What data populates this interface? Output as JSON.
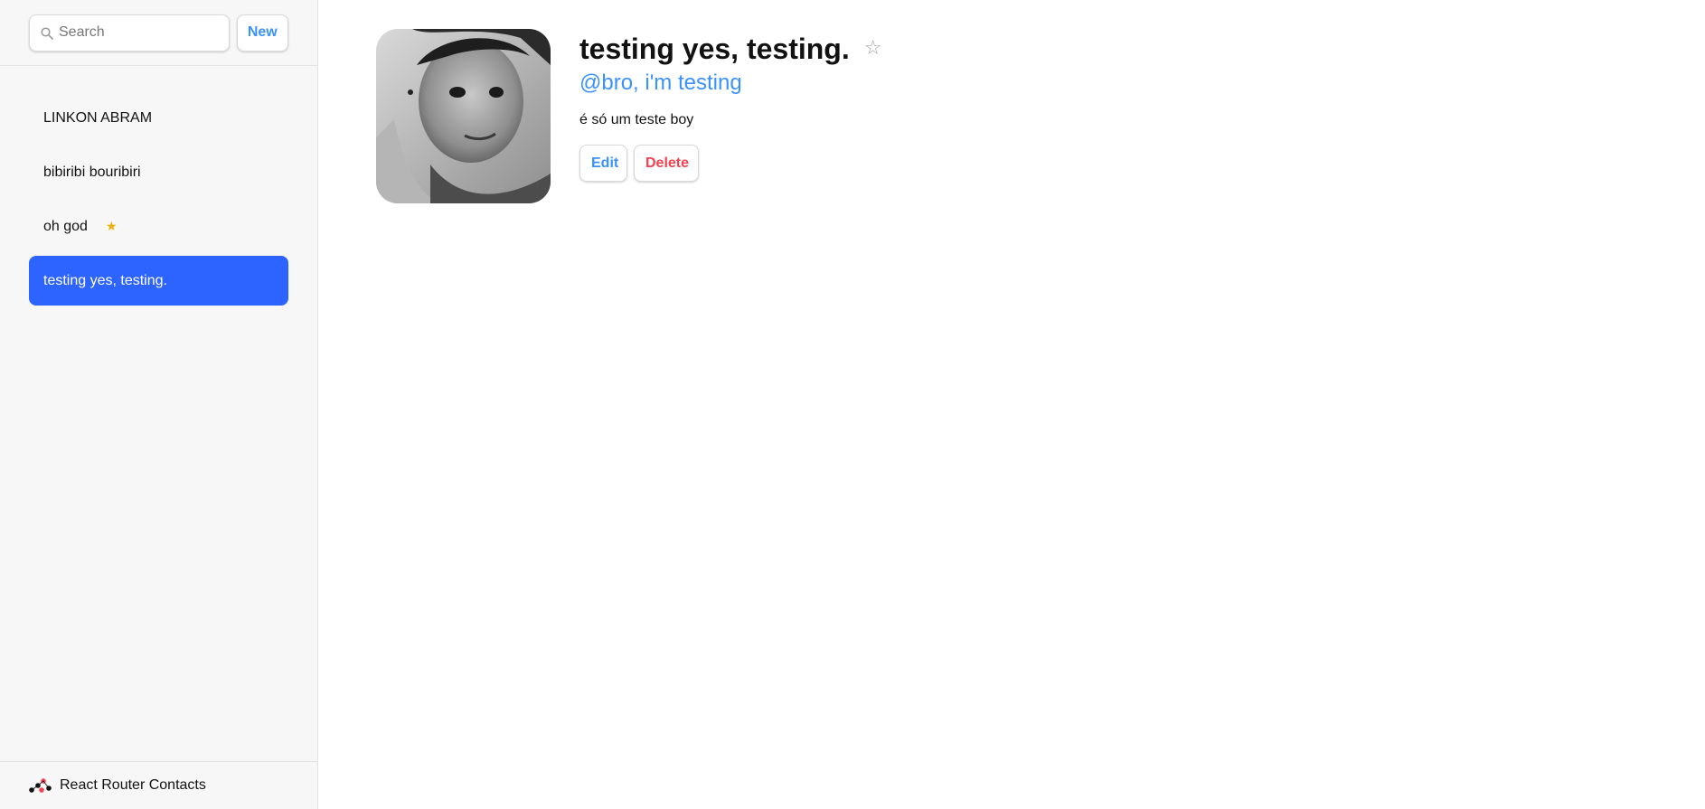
{
  "colors": {
    "accent": "#3992ff",
    "active_item": "#2d64ff",
    "danger": "#f44250",
    "favorite_star": "#eeb004"
  },
  "sidebar": {
    "search": {
      "placeholder": "Search",
      "value": ""
    },
    "new_label": "New",
    "contacts": [
      {
        "name": "LINKON ABRAM",
        "favorite": false,
        "active": false
      },
      {
        "name": "bibiribi bouribiri",
        "favorite": false,
        "active": false
      },
      {
        "name": "oh god",
        "favorite": true,
        "active": false
      },
      {
        "name": "testing yes, testing.",
        "favorite": false,
        "active": true
      }
    ],
    "favorite_icon": "★",
    "footer": {
      "title": "React Router Contacts",
      "logo_icon": "react-router-logo-icon"
    }
  },
  "detail": {
    "name": "testing yes, testing.",
    "favorite_icon": "☆",
    "handle": "@bro, i'm testing",
    "notes": "é só um teste boy",
    "edit_label": "Edit",
    "delete_label": "Delete"
  }
}
